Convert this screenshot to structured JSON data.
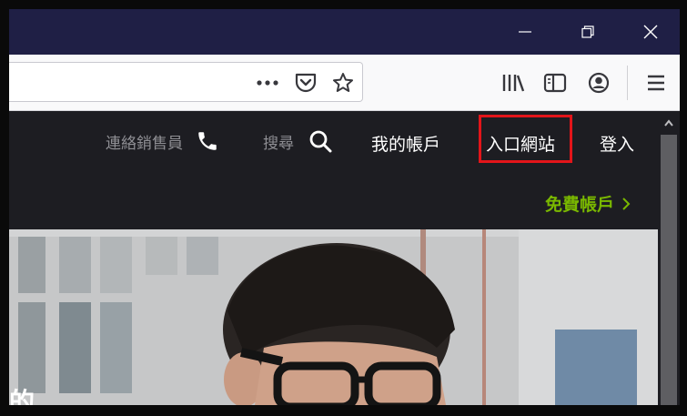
{
  "window": {
    "min_icon": "minimize-icon",
    "restore_icon": "restore-icon",
    "close_icon": "close-icon"
  },
  "toolbar": {
    "page_actions_icon": "more-horizontal-icon",
    "pocket_icon": "pocket-icon",
    "bookmark_icon": "star-icon",
    "library_icon": "library-icon",
    "sidebar_icon": "sidebar-icon",
    "account_icon": "account-icon",
    "menu_icon": "hamburger-menu-icon"
  },
  "site_nav": {
    "contact_sales": "連絡銷售員",
    "search": "搜尋",
    "my_account": "我的帳戶",
    "portal": "入口網站",
    "login": "登入",
    "free_account": "免費帳戶"
  },
  "hero": {
    "partial_text": "的"
  },
  "colors": {
    "titlebar": "#1f1f45",
    "site_header": "#1d1d22",
    "accent_green": "#7ab800",
    "highlight_red": "#e3151a"
  }
}
